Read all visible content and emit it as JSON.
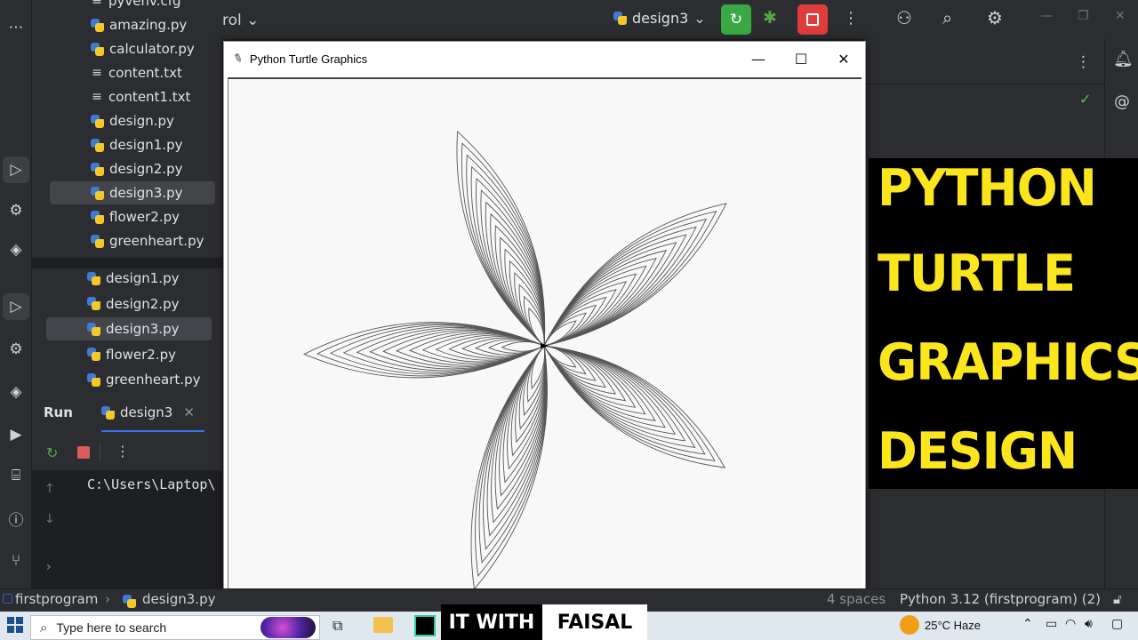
{
  "project_tree": {
    "items_upper": [
      {
        "label": "pyvenv.cfg",
        "icon": "text-file-icon"
      },
      {
        "label": "amazing.py",
        "icon": "python-file-icon"
      },
      {
        "label": "calculator.py",
        "icon": "python-file-icon"
      },
      {
        "label": "content.txt",
        "icon": "text-file-icon"
      },
      {
        "label": "content1.txt",
        "icon": "text-file-icon"
      },
      {
        "label": "design.py",
        "icon": "python-file-icon"
      },
      {
        "label": "design1.py",
        "icon": "python-file-icon"
      },
      {
        "label": "design2.py",
        "icon": "python-file-icon"
      },
      {
        "label": "design3.py",
        "icon": "python-file-icon",
        "selected": true
      },
      {
        "label": "flower2.py",
        "icon": "python-file-icon"
      },
      {
        "label": "greenheart.py",
        "icon": "python-file-icon"
      }
    ],
    "items_lower": [
      {
        "label": "design1.py",
        "icon": "python-file-icon"
      },
      {
        "label": "design2.py",
        "icon": "python-file-icon"
      },
      {
        "label": "design3.py",
        "icon": "python-file-icon",
        "selected": true
      },
      {
        "label": "flower2.py",
        "icon": "python-file-icon"
      },
      {
        "label": "greenheart.py",
        "icon": "python-file-icon"
      }
    ]
  },
  "run_panel": {
    "title": "Run",
    "tab_label": "design3",
    "console_line": "C:\\Users\\Laptop\\"
  },
  "toolbar": {
    "vcs_fragment": "rol",
    "run_config": "design3"
  },
  "turtle_window": {
    "title": "Python Turtle Graphics",
    "minimize": "—",
    "maximize": "☐",
    "close": "✕"
  },
  "banner": {
    "lines": [
      "PYTHON",
      "TURTLE",
      "GRAPHICS",
      "DESIGN"
    ],
    "text_color": "#fbe61e",
    "background": "#000000"
  },
  "status_bar": {
    "project": "firstprogram",
    "file": "design3.py",
    "spaces": "4 spaces",
    "interpreter": "Python 3.12 (firstprogram) (2)"
  },
  "taskbar": {
    "search_placeholder": "Type here to search",
    "weather": "25°C  Haze",
    "watermark_left": "IT WITH",
    "watermark_right": "FAISAL"
  },
  "drawing": {
    "petal_count": 5,
    "stroke_color": "#555555"
  }
}
